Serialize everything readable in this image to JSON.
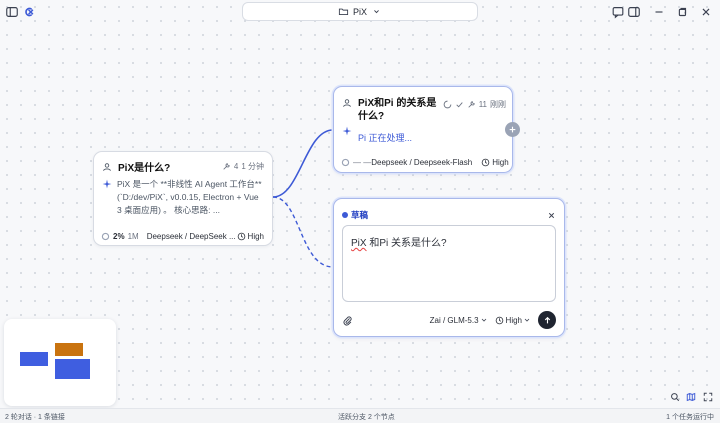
{
  "header": {
    "title": "PiX"
  },
  "node_root": {
    "question": "PiX是什么?",
    "stat_tokens": "4",
    "stat_time": "1 分钟",
    "body": "PiX 是一个 **非线性 AI Agent 工作台** (`D:/dev/PiX`, v0.0.15, Electron + Vue 3 桌面应用) 。 核心思路: ...",
    "context_pct": "2%",
    "context_size": "1M",
    "model": "Deepseek / DeepSeek ...",
    "effort": "High"
  },
  "node_child": {
    "question": "PiX和Pi 的关系是什么?",
    "stat_tokens": "11",
    "stat_time": "刚刚",
    "status": "Pi 正在处理...",
    "context_placeholder": "— —",
    "model": "Deepseek / Deepseek-Flash",
    "effort": "High"
  },
  "draft": {
    "label": "草稿",
    "input_value": "PiX 和Pi 关系是什么?",
    "input_misspelled": "PiX",
    "input_rest": " 和Pi 关系是什么?",
    "model": "Zai / GLM-5.3",
    "effort": "High"
  },
  "status_bar": {
    "left": "2 轮对话 · 1 条链接",
    "center": "活跃分支 2 个节点",
    "right": "1 个任务运行中"
  },
  "colors": {
    "accent": "#3d5ad6",
    "edge": "#3d5ad6",
    "minimap_blue": "#3f5ee0",
    "minimap_orange": "#c9730f"
  },
  "icons": [
    "sidebar-icon",
    "logo-icon",
    "folder-icon",
    "chat-icon",
    "panel-icon",
    "minimize-icon",
    "close-icon",
    "user-icon",
    "sparkle-icon",
    "spinner-icon",
    "check-icon",
    "plus-icon",
    "shield-icon",
    "paperclip-icon",
    "send-icon",
    "search-icon",
    "map-icon",
    "fit-icon"
  ]
}
